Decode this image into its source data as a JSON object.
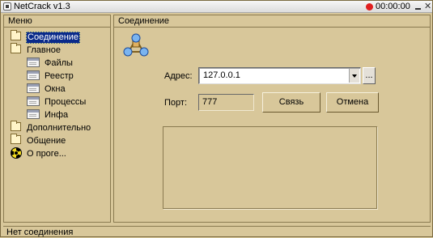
{
  "window": {
    "title": "NetCrack v1.3",
    "timer": "00:00:00"
  },
  "menu": {
    "header": "Меню",
    "items": [
      {
        "label": "Соединение",
        "icon": "folder-icon",
        "selected": true
      },
      {
        "label": "Главное",
        "icon": "folder-icon"
      },
      {
        "label": "Файлы",
        "icon": "window-icon"
      },
      {
        "label": "Реестр",
        "icon": "window-icon"
      },
      {
        "label": "Окна",
        "icon": "window-icon"
      },
      {
        "label": "Процессы",
        "icon": "window-icon"
      },
      {
        "label": "Инфа",
        "icon": "window-icon"
      },
      {
        "label": "Дополнительно",
        "icon": "folder-icon"
      },
      {
        "label": "Общение",
        "icon": "folder-icon"
      },
      {
        "label": "О проге...",
        "icon": "radiation-icon"
      }
    ]
  },
  "connection": {
    "header": "Соединение",
    "address_label": "Адрес:",
    "address_value": "127.0.0.1",
    "browse_label": "...",
    "port_label": "Порт:",
    "port_value": "777",
    "connect_label": "Связь",
    "cancel_label": "Отмена"
  },
  "status": {
    "text": "Нет соединения"
  }
}
